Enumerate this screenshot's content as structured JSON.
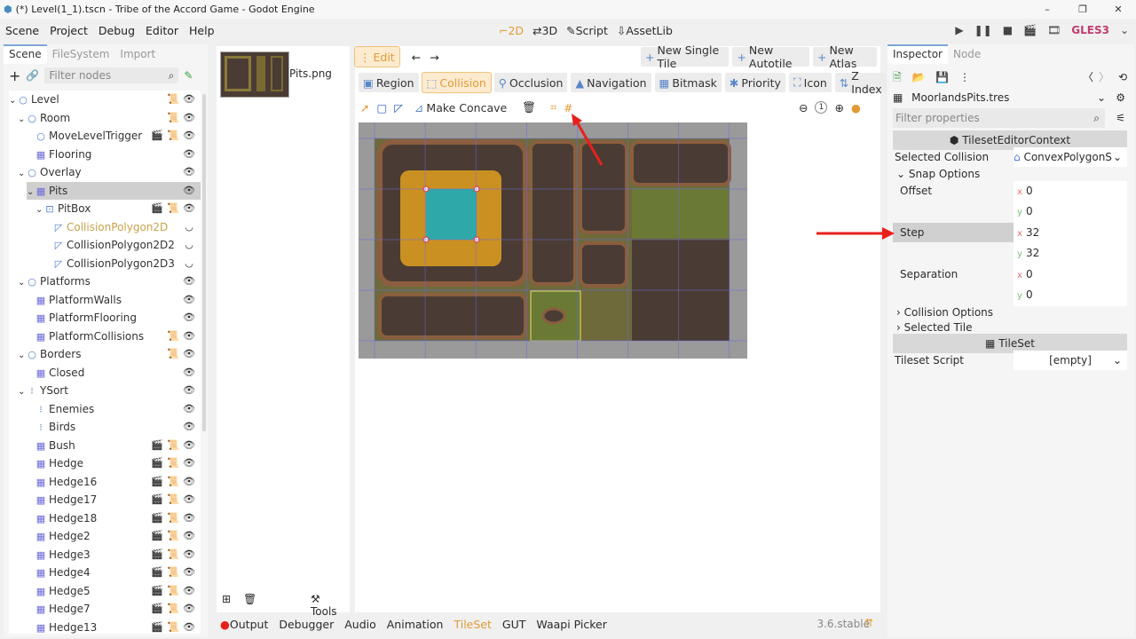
{
  "window": {
    "title": "(*) Level(1_1).tscn - Tribe of the Accord Game - Godot Engine",
    "controls": [
      "–",
      "❐",
      "✕"
    ]
  },
  "menu": [
    "Scene",
    "Project",
    "Debug",
    "Editor",
    "Help"
  ],
  "main_modes": [
    {
      "label": "2D",
      "icon": "2d-icon",
      "active": true
    },
    {
      "label": "3D",
      "icon": "3d-icon"
    },
    {
      "label": "Script",
      "icon": "script-icon"
    },
    {
      "label": "AssetLib",
      "icon": "assetlib-icon"
    }
  ],
  "renderer": "GLES3",
  "left_dock": {
    "tabs": [
      "Scene",
      "FileSystem",
      "Import"
    ],
    "filter_placeholder": "Filter nodes",
    "nodes": [
      {
        "label": "Level",
        "indent": 0,
        "icon": "node2d-icon",
        "fold": "v",
        "icons": [
          "script",
          "eye"
        ]
      },
      {
        "label": "Room",
        "indent": 1,
        "icon": "node2d-icon",
        "fold": "v",
        "icons": [
          "script",
          "eye"
        ]
      },
      {
        "label": "MoveLevelTrigger",
        "indent": 2,
        "icon": "node2d-icon",
        "icons": [
          "clap",
          "script",
          "eye"
        ]
      },
      {
        "label": "Flooring",
        "indent": 2,
        "icon": "tilemap-icon",
        "icons": [
          "eye"
        ]
      },
      {
        "label": "Overlay",
        "indent": 1,
        "icon": "node2d-icon",
        "fold": "v",
        "icons": [
          "eye"
        ]
      },
      {
        "label": "Pits",
        "indent": 2,
        "icon": "tilemap-icon",
        "fold": "v",
        "icons": [
          "eye"
        ],
        "selected": true
      },
      {
        "label": "PitBox",
        "indent": 3,
        "icon": "area-icon",
        "fold": "v",
        "icons": [
          "clap",
          "script",
          "eye"
        ]
      },
      {
        "label": "CollisionPolygon2D",
        "indent": 4,
        "icon": "polygon-icon",
        "icons": [
          "hidden"
        ],
        "highlight": true
      },
      {
        "label": "CollisionPolygon2D2",
        "indent": 4,
        "icon": "polygon-icon",
        "icons": [
          "hidden"
        ]
      },
      {
        "label": "CollisionPolygon2D3",
        "indent": 4,
        "icon": "polygon-icon",
        "icons": [
          "hidden"
        ]
      },
      {
        "label": "Platforms",
        "indent": 1,
        "icon": "node2d-icon",
        "fold": "v",
        "icons": [
          "eye"
        ]
      },
      {
        "label": "PlatformWalls",
        "indent": 2,
        "icon": "tilemap-icon",
        "icons": [
          "eye"
        ]
      },
      {
        "label": "PlatformFlooring",
        "indent": 2,
        "icon": "tilemap-icon",
        "icons": [
          "eye"
        ]
      },
      {
        "label": "PlatformCollisions",
        "indent": 2,
        "icon": "tilemap-icon",
        "icons": [
          "script",
          "eye"
        ]
      },
      {
        "label": "Borders",
        "indent": 1,
        "icon": "node2d-icon",
        "fold": "v",
        "icons": [
          "script",
          "eye"
        ]
      },
      {
        "label": "Closed",
        "indent": 2,
        "icon": "tilemap-icon",
        "icons": [
          "eye"
        ]
      },
      {
        "label": "YSort",
        "indent": 1,
        "icon": "ysort-icon",
        "fold": "v",
        "icons": [
          "eye"
        ]
      },
      {
        "label": "Enemies",
        "indent": 2,
        "icon": "ysort-icon",
        "icons": [
          "eye"
        ]
      },
      {
        "label": "Birds",
        "indent": 2,
        "icon": "ysort-icon",
        "icons": [
          "eye"
        ]
      },
      {
        "label": "Bush",
        "indent": 2,
        "icon": "tilemap-icon",
        "icons": [
          "clap",
          "script",
          "eye"
        ]
      },
      {
        "label": "Hedge",
        "indent": 2,
        "icon": "tilemap-icon",
        "icons": [
          "clap",
          "script",
          "eye"
        ]
      },
      {
        "label": "Hedge16",
        "indent": 2,
        "icon": "tilemap-icon",
        "icons": [
          "clap",
          "script",
          "eye"
        ]
      },
      {
        "label": "Hedge17",
        "indent": 2,
        "icon": "tilemap-icon",
        "icons": [
          "clap",
          "script",
          "eye"
        ]
      },
      {
        "label": "Hedge18",
        "indent": 2,
        "icon": "tilemap-icon",
        "icons": [
          "clap",
          "script",
          "eye"
        ]
      },
      {
        "label": "Hedge2",
        "indent": 2,
        "icon": "tilemap-icon",
        "icons": [
          "clap",
          "script",
          "eye"
        ]
      },
      {
        "label": "Hedge3",
        "indent": 2,
        "icon": "tilemap-icon",
        "icons": [
          "clap",
          "script",
          "eye"
        ]
      },
      {
        "label": "Hedge4",
        "indent": 2,
        "icon": "tilemap-icon",
        "icons": [
          "clap",
          "script",
          "eye"
        ]
      },
      {
        "label": "Hedge5",
        "indent": 2,
        "icon": "tilemap-icon",
        "icons": [
          "clap",
          "script",
          "eye"
        ]
      },
      {
        "label": "Hedge7",
        "indent": 2,
        "icon": "tilemap-icon",
        "icons": [
          "clap",
          "script",
          "eye"
        ]
      },
      {
        "label": "Hedge13",
        "indent": 2,
        "icon": "tilemap-icon",
        "icons": [
          "clap",
          "script",
          "eye"
        ]
      }
    ]
  },
  "tile_list": {
    "texture_label": "Pits.png",
    "tools_label": "Tools"
  },
  "tileset_editor": {
    "edit_label": "Edit",
    "top_buttons": [
      "New Single Tile",
      "New Autotile",
      "New Atlas"
    ],
    "modes": [
      {
        "label": "Region",
        "icon": "region-icon"
      },
      {
        "label": "Collision",
        "icon": "collision-icon",
        "active": true
      },
      {
        "label": "Occlusion",
        "icon": "occlusion-icon"
      },
      {
        "label": "Navigation",
        "icon": "navigation-icon"
      },
      {
        "label": "Bitmask",
        "icon": "bitmask-icon"
      },
      {
        "label": "Priority",
        "icon": "priority-icon"
      },
      {
        "label": "Icon",
        "icon": "icon-icon"
      },
      {
        "label": "Z Index",
        "icon": "zindex-icon"
      }
    ],
    "make_concave_label": "Make Concave",
    "zoom_reset_label": "1"
  },
  "bottom_panel": {
    "tabs": [
      "Output",
      "Debugger",
      "Audio",
      "Animation",
      "TileSet",
      "GUT",
      "Waapi Picker"
    ],
    "active_tab": "TileSet",
    "version": "3.6.stable"
  },
  "inspector": {
    "tabs": [
      "Inspector",
      "Node"
    ],
    "resource_name": "MoorlandsPits.tres",
    "filter_placeholder": "Filter properties",
    "context_label": "TilesetEditorContext",
    "selected_collision_label": "Selected Collision",
    "selected_collision_value": "ConvexPolygonS",
    "snap_options_label": "Snap Options",
    "offset_label": "Offset",
    "offset_x": "0",
    "offset_y": "0",
    "step_label": "Step",
    "step_x": "32",
    "step_y": "32",
    "separation_label": "Separation",
    "separation_x": "0",
    "separation_y": "0",
    "collision_options_label": "Collision Options",
    "selected_tile_label": "Selected Tile",
    "tileset_label": "TileSet",
    "tileset_script_label": "Tileset Script",
    "tileset_script_value": "[empty]",
    "axis_x": "x",
    "axis_y": "y"
  },
  "colors": {
    "accent": "#e39a35",
    "annotation_arrow": "#e8201c",
    "selection": "#cfcfcf"
  }
}
